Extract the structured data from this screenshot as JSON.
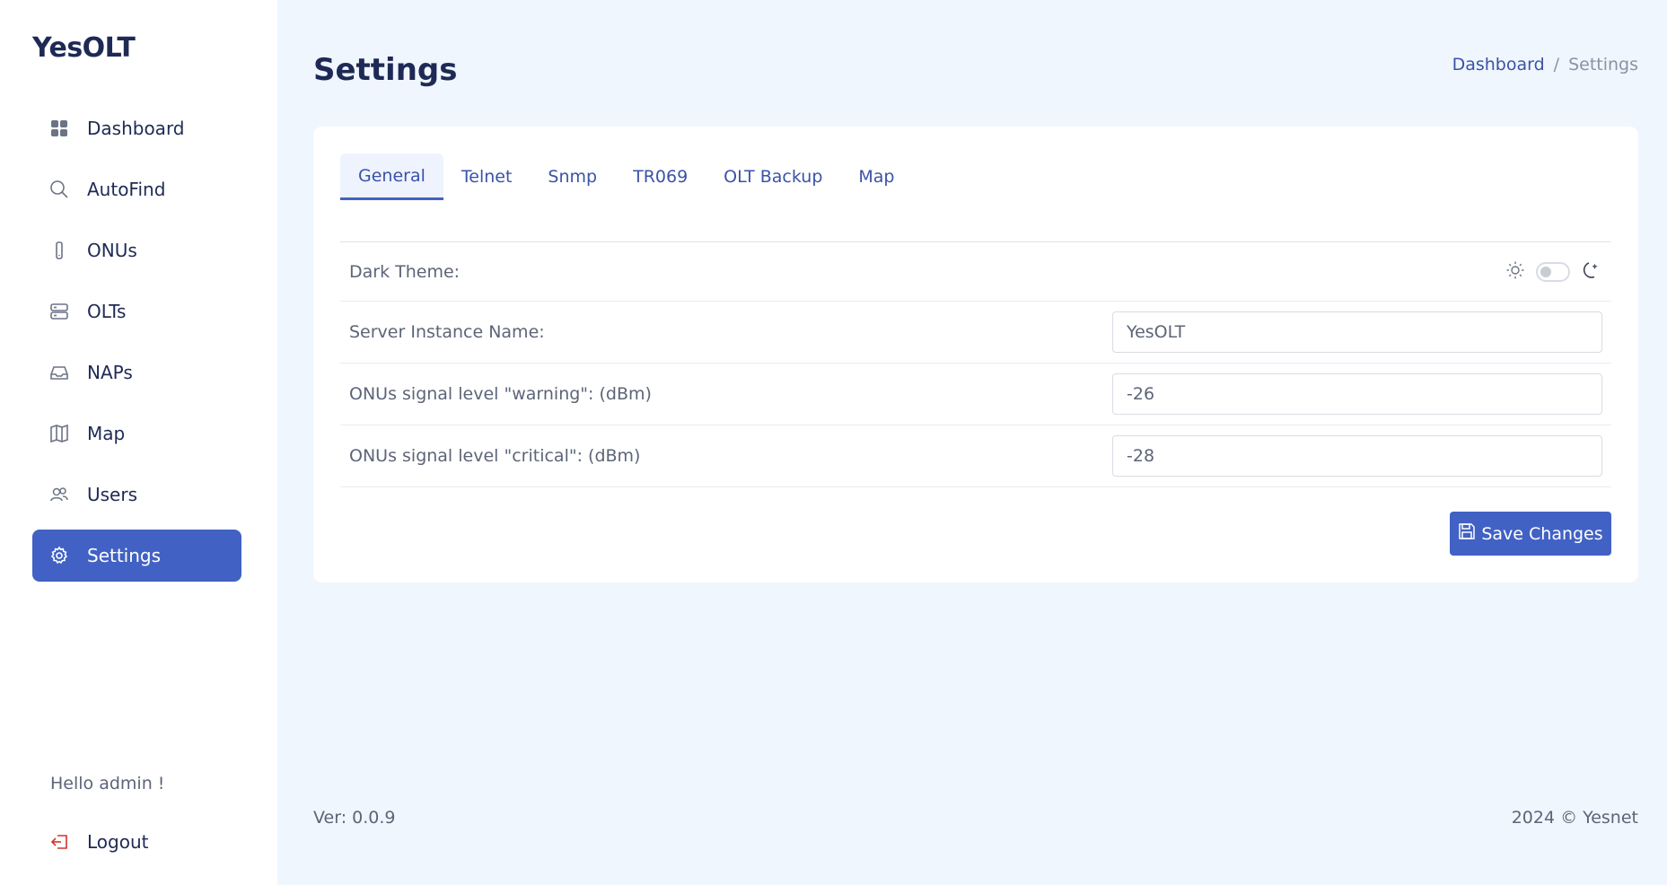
{
  "app": {
    "brand": "YesOLT"
  },
  "sidebar": {
    "items": [
      {
        "label": "Dashboard",
        "icon": "grid-icon"
      },
      {
        "label": "AutoFind",
        "icon": "search-icon"
      },
      {
        "label": "ONUs",
        "icon": "device-icon"
      },
      {
        "label": "OLTs",
        "icon": "server-icon"
      },
      {
        "label": "NAPs",
        "icon": "inbox-icon"
      },
      {
        "label": "Map",
        "icon": "map-icon"
      },
      {
        "label": "Users",
        "icon": "users-icon"
      },
      {
        "label": "Settings",
        "icon": "gear-icon",
        "active": true
      }
    ],
    "greeting": "Hello admin !",
    "logout_label": "Logout"
  },
  "header": {
    "title": "Settings",
    "breadcrumb": {
      "parent": "Dashboard",
      "separator": "/",
      "current": "Settings"
    }
  },
  "tabs": [
    {
      "label": "General",
      "active": true
    },
    {
      "label": "Telnet"
    },
    {
      "label": "Snmp"
    },
    {
      "label": "TR069"
    },
    {
      "label": "OLT Backup"
    },
    {
      "label": "Map"
    }
  ],
  "form": {
    "dark_theme_label": "Dark Theme:",
    "dark_theme_enabled": false,
    "server_name_label": "Server Instance Name:",
    "server_name_value": "YesOLT",
    "warning_label": "ONUs signal level \"warning\": (dBm)",
    "warning_value": "-26",
    "critical_label": "ONUs signal level \"critical\": (dBm)",
    "critical_value": "-28",
    "save_label": "Save Changes"
  },
  "footer": {
    "version": "Ver: 0.0.9",
    "copyright": "2024 © Yesnet"
  },
  "colors": {
    "accent": "#4161c4",
    "background": "#f0f6fe",
    "logout_icon": "#d0342c"
  }
}
